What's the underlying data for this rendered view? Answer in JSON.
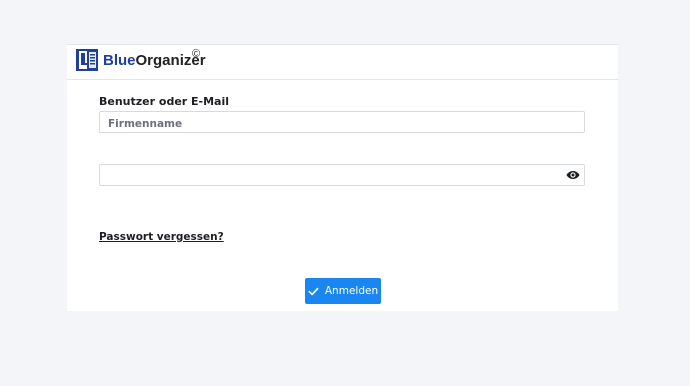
{
  "brand": {
    "name_part1": "Blue",
    "name_part2": "Organizer",
    "copyright": "©",
    "colors": {
      "blue": "#1f3f9a",
      "dark": "#222222"
    }
  },
  "form": {
    "user_label": "Benutzer oder E-Mail",
    "user_placeholder": "Firmenname",
    "user_value": "",
    "password_value": "",
    "password_toggle_icon": "eye-icon",
    "forgot_link": "Passwort vergessen?",
    "submit_label": "Anmelden",
    "submit_icon": "check-icon",
    "accent": "#1a86f2"
  }
}
